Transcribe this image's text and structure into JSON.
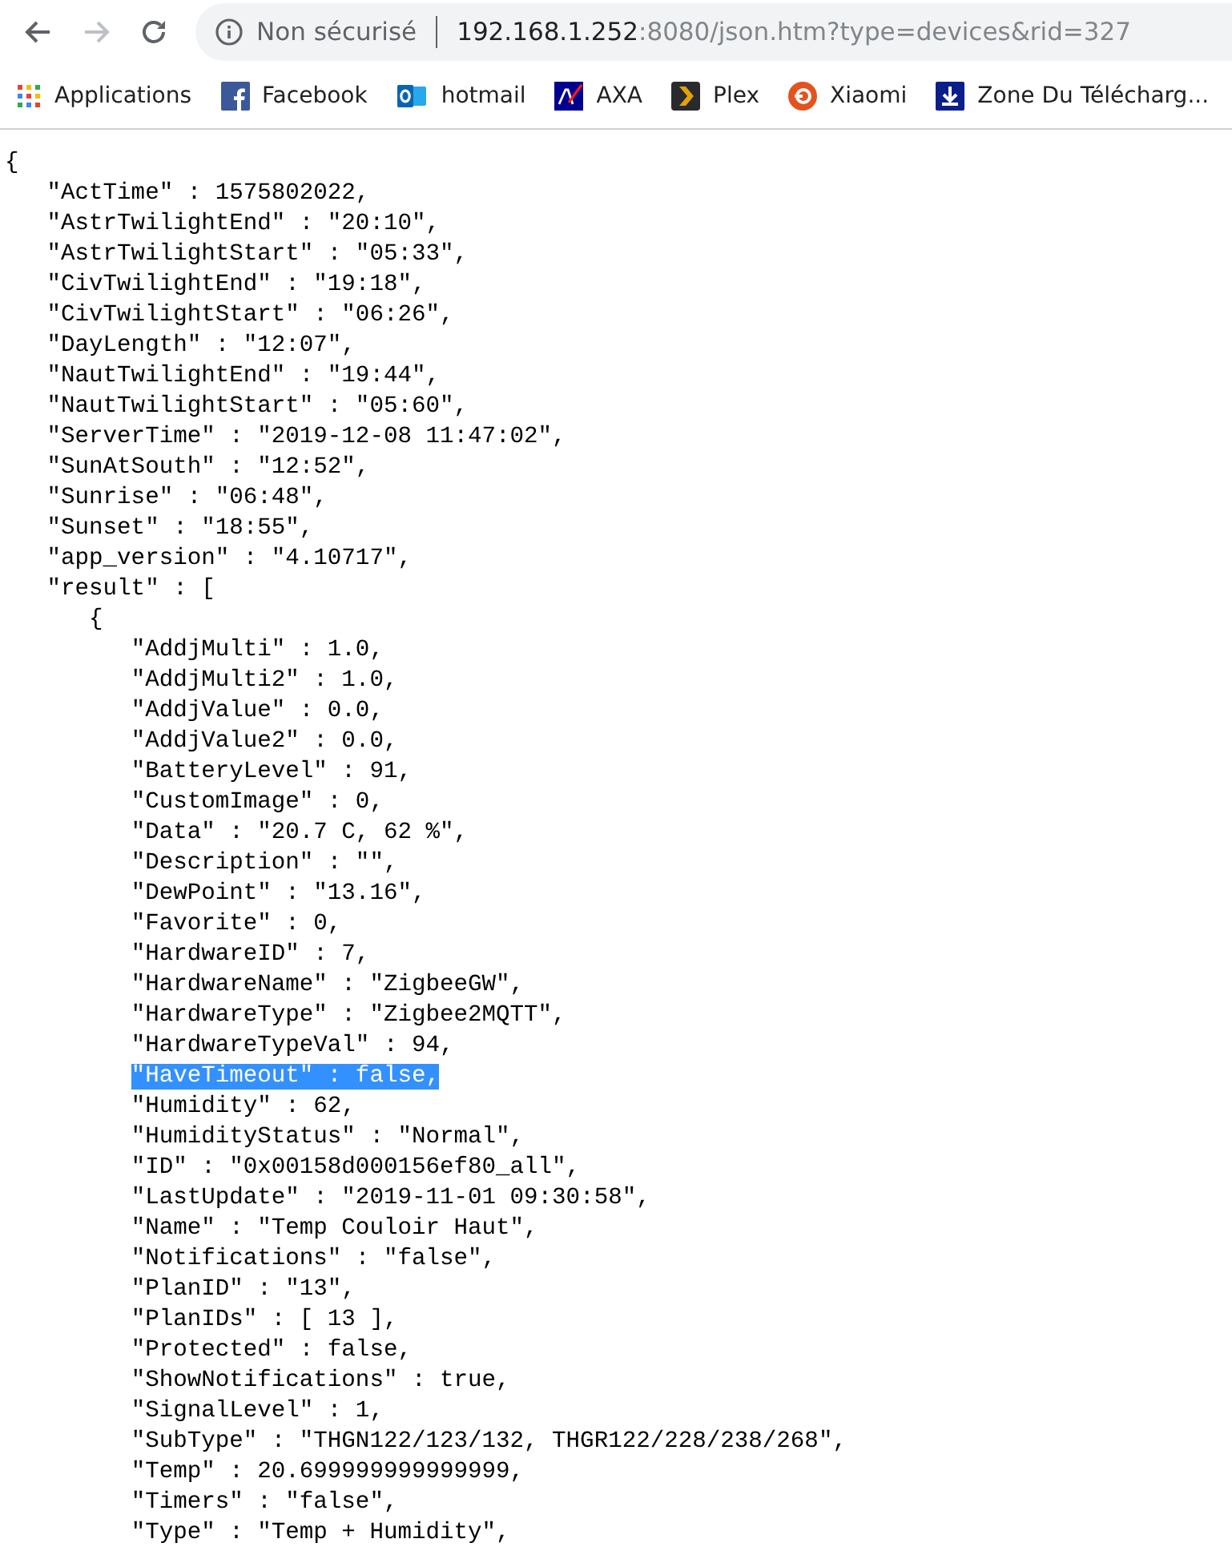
{
  "toolbar": {
    "back_disabled": false,
    "forward_disabled": true,
    "security_label": "Non sécurisé",
    "url_host": "192.168.1.252",
    "url_rest": ":8080/json.htm?type=devices&rid=327"
  },
  "bookmarks": [
    {
      "label": "Applications",
      "kind": "apps"
    },
    {
      "label": "Facebook",
      "kind": "facebook"
    },
    {
      "label": "hotmail",
      "kind": "outlook"
    },
    {
      "label": "AXA",
      "kind": "axa"
    },
    {
      "label": "Plex",
      "kind": "plex"
    },
    {
      "label": "Xiaomi",
      "kind": "xiaomi"
    },
    {
      "label": "Zone Du Télécharg...",
      "kind": "download"
    }
  ],
  "document": {
    "text": "{",
    "selected": false,
    "children": [
      {
        "text": "\"ActTime\" : 1575802022,",
        "selected": false
      },
      {
        "text": "\"AstrTwilightEnd\" : \"20:10\",",
        "selected": false
      },
      {
        "text": "\"AstrTwilightStart\" : \"05:33\",",
        "selected": false
      },
      {
        "text": "\"CivTwilightEnd\" : \"19:18\",",
        "selected": false
      },
      {
        "text": "\"CivTwilightStart\" : \"06:26\",",
        "selected": false
      },
      {
        "text": "\"DayLength\" : \"12:07\",",
        "selected": false
      },
      {
        "text": "\"NautTwilightEnd\" : \"19:44\",",
        "selected": false
      },
      {
        "text": "\"NautTwilightStart\" : \"05:60\",",
        "selected": false
      },
      {
        "text": "\"ServerTime\" : \"2019-12-08 11:47:02\",",
        "selected": false
      },
      {
        "text": "\"SunAtSouth\" : \"12:52\",",
        "selected": false
      },
      {
        "text": "\"Sunrise\" : \"06:48\",",
        "selected": false
      },
      {
        "text": "\"Sunset\" : \"18:55\",",
        "selected": false
      },
      {
        "text": "\"app_version\" : \"4.10717\",",
        "selected": false
      },
      {
        "text": "\"result\" : [",
        "selected": false,
        "children": [
          {
            "text": "{",
            "selected": false,
            "children": [
              {
                "text": "\"AddjMulti\" : 1.0,",
                "selected": false
              },
              {
                "text": "\"AddjMulti2\" : 1.0,",
                "selected": false
              },
              {
                "text": "\"AddjValue\" : 0.0,",
                "selected": false
              },
              {
                "text": "\"AddjValue2\" : 0.0,",
                "selected": false
              },
              {
                "text": "\"BatteryLevel\" : 91,",
                "selected": false
              },
              {
                "text": "\"CustomImage\" : 0,",
                "selected": false
              },
              {
                "text": "\"Data\" : \"20.7 C, 62 %\",",
                "selected": false
              },
              {
                "text": "\"Description\" : \"\",",
                "selected": false
              },
              {
                "text": "\"DewPoint\" : \"13.16\",",
                "selected": false
              },
              {
                "text": "\"Favorite\" : 0,",
                "selected": false
              },
              {
                "text": "\"HardwareID\" : 7,",
                "selected": false
              },
              {
                "text": "\"HardwareName\" : \"ZigbeeGW\",",
                "selected": false
              },
              {
                "text": "\"HardwareType\" : \"Zigbee2MQTT\",",
                "selected": false
              },
              {
                "text": "\"HardwareTypeVal\" : 94,",
                "selected": false
              },
              {
                "text": "\"HaveTimeout\" : false,",
                "selected": true
              },
              {
                "text": "\"Humidity\" : 62,",
                "selected": false
              },
              {
                "text": "\"HumidityStatus\" : \"Normal\",",
                "selected": false
              },
              {
                "text": "\"ID\" : \"0x00158d000156ef80_all\",",
                "selected": false
              },
              {
                "text": "\"LastUpdate\" : \"2019-11-01 09:30:58\",",
                "selected": false
              },
              {
                "text": "\"Name\" : \"Temp Couloir Haut\",",
                "selected": false
              },
              {
                "text": "\"Notifications\" : \"false\",",
                "selected": false
              },
              {
                "text": "\"PlanID\" : \"13\",",
                "selected": false
              },
              {
                "text": "\"PlanIDs\" : [ 13 ],",
                "selected": false
              },
              {
                "text": "\"Protected\" : false,",
                "selected": false
              },
              {
                "text": "\"ShowNotifications\" : true,",
                "selected": false
              },
              {
                "text": "\"SignalLevel\" : 1,",
                "selected": false
              },
              {
                "text": "\"SubType\" : \"THGN122/123/132, THGR122/228/238/268\",",
                "selected": false
              },
              {
                "text": "\"Temp\" : 20.699999999999999,",
                "selected": false
              },
              {
                "text": "\"Timers\" : \"false\",",
                "selected": false
              },
              {
                "text": "\"Type\" : \"Temp + Humidity\",",
                "selected": false
              }
            ]
          }
        ]
      }
    ]
  }
}
